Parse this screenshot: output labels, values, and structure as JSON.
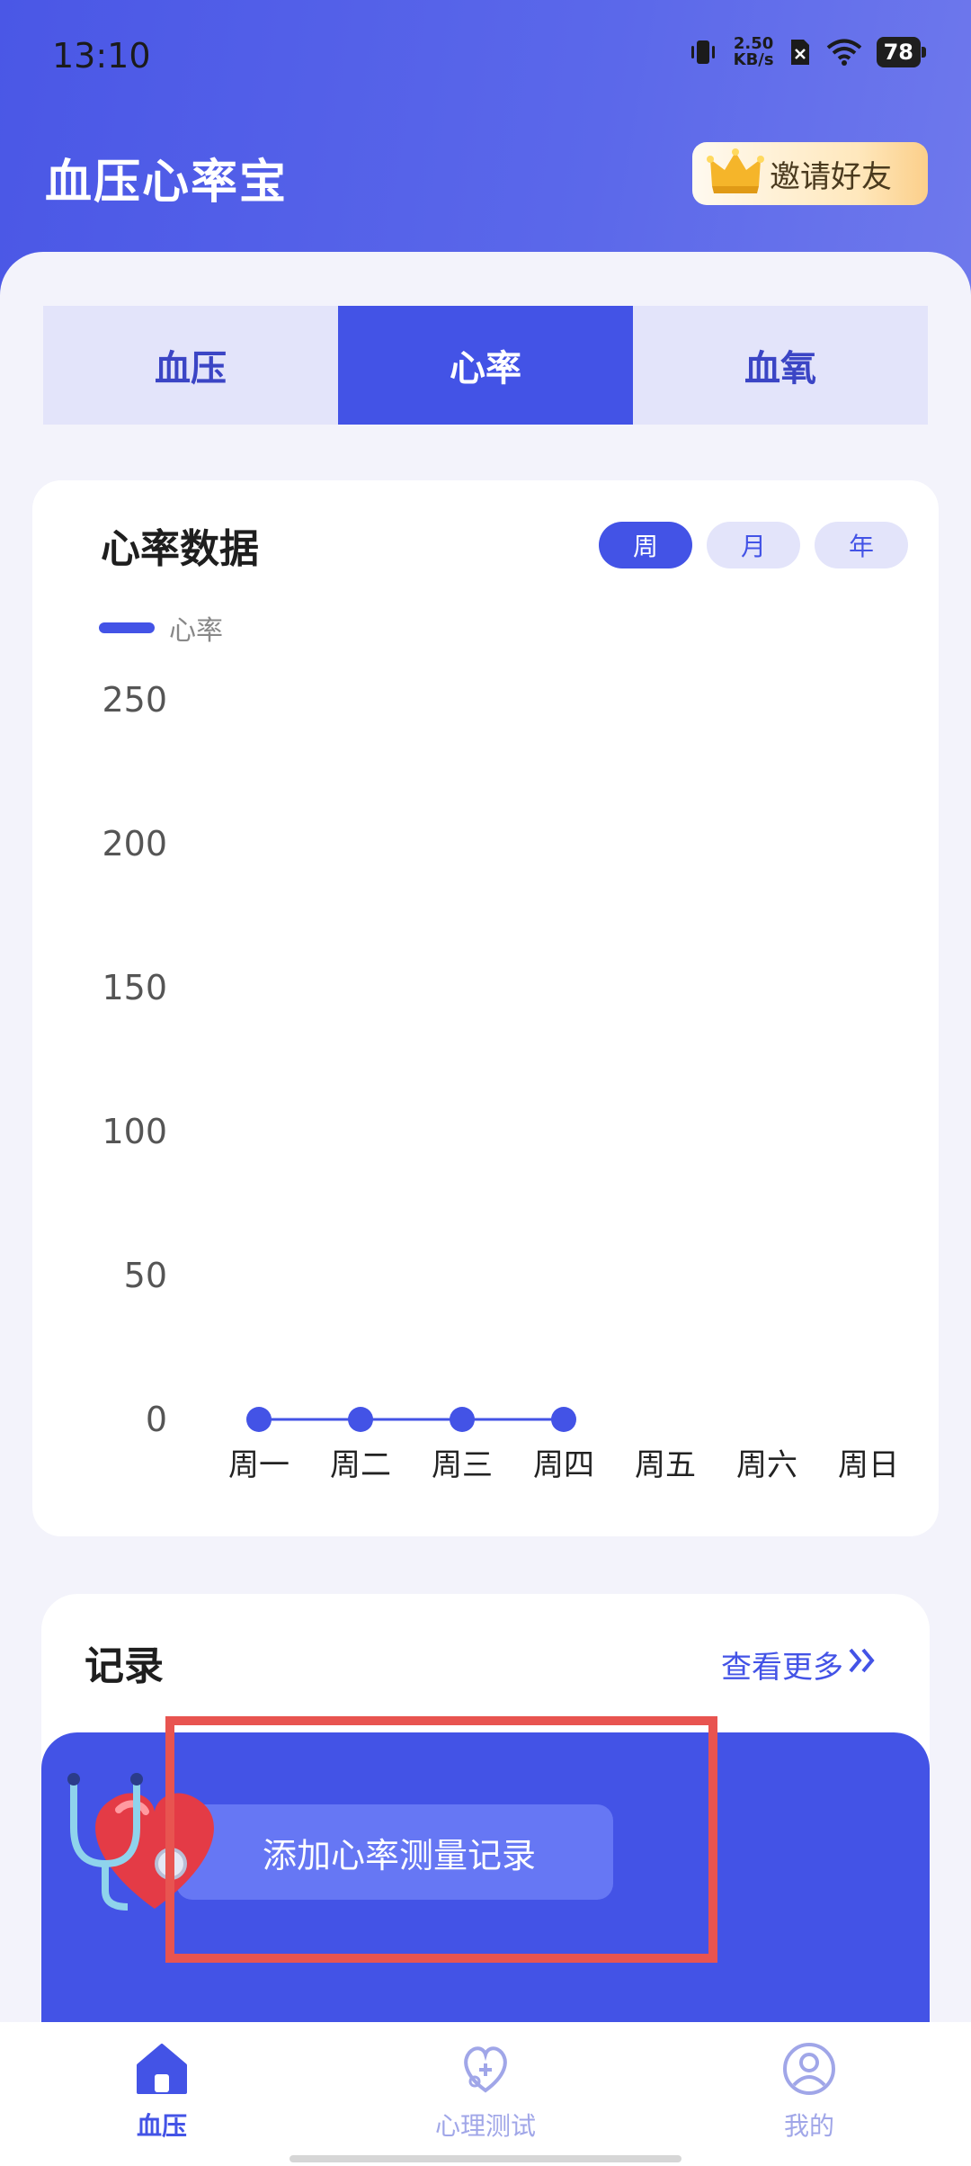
{
  "status_bar": {
    "time": "13:10",
    "net_speed_value": "2.50",
    "net_speed_unit": "KB/s",
    "battery": "78",
    "icons": [
      "vibrate-icon",
      "sim-off-icon",
      "wifi-icon",
      "battery-icon"
    ]
  },
  "header": {
    "title": "血压心率宝",
    "invite_label": "邀请好友",
    "invite_icon": "crown-icon"
  },
  "tabs": [
    {
      "label": "血压",
      "active": false
    },
    {
      "label": "心率",
      "active": true
    },
    {
      "label": "血氧",
      "active": false
    }
  ],
  "chart_card": {
    "title": "心率数据",
    "range_tabs": [
      {
        "label": "周",
        "active": true
      },
      {
        "label": "月",
        "active": false
      },
      {
        "label": "年",
        "active": false
      }
    ],
    "legend_label": "心率"
  },
  "chart_data": {
    "type": "line",
    "categories": [
      "周一",
      "周二",
      "周三",
      "周四",
      "周五",
      "周六",
      "周日"
    ],
    "series": [
      {
        "name": "心率",
        "values": [
          0,
          0,
          0,
          0,
          null,
          null,
          null
        ]
      }
    ],
    "y_ticks": [
      "250",
      "200",
      "150",
      "100",
      "50",
      "0"
    ],
    "ylim": [
      0,
      250
    ],
    "grid": false,
    "legend_position": "top-left",
    "color": "#4353e6"
  },
  "records": {
    "title": "记录",
    "more_label": "查看更多",
    "add_label": "添加心率测量记录"
  },
  "bottom_nav": [
    {
      "label": "血压",
      "icon": "home-icon",
      "active": true
    },
    {
      "label": "心理测试",
      "icon": "heart-stethoscope-icon",
      "active": false
    },
    {
      "label": "我的",
      "icon": "user-icon",
      "active": false
    }
  ],
  "colors": {
    "accent": "#4353e6",
    "tab_inactive_bg": "#e3e4fa",
    "highlight": "#e85450"
  }
}
